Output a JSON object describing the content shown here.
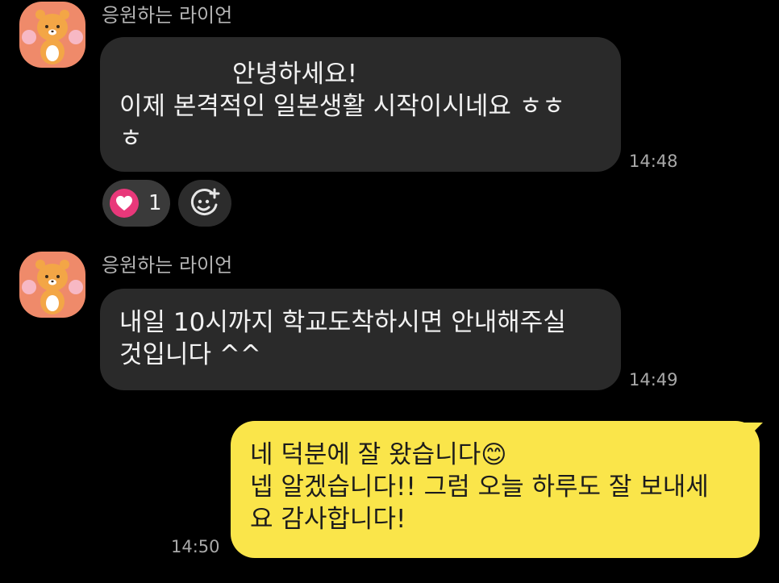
{
  "colors": {
    "background": "#000000",
    "incoming_bubble": "#2a2a2a",
    "outgoing_bubble": "#fae54a",
    "heart_reaction": "#e8387a",
    "avatar_bg": "#ef8a6a"
  },
  "messages": [
    {
      "sender": "응원하는 라이언",
      "lines": [
        "안녕하세요!",
        "이제 본격적인 일본생활 시작이시네요 ㅎㅎ",
        "ㅎ"
      ],
      "time": "14:48",
      "reaction": {
        "icon": "heart-icon",
        "count": "1"
      },
      "add_reaction_icon": "add-emoji-icon"
    },
    {
      "sender": "응원하는 라이언",
      "lines": [
        "내일 10시까지 학교도착하시면 안내해주실",
        "것입니다 ^^"
      ],
      "time": "14:49"
    },
    {
      "lines": [
        "네 덕분에 잘 왔습니다😊",
        "넵 알겠습니다!! 그럼 오늘 하루도 잘 보내세",
        "요 감사합니다!"
      ],
      "time": "14:50"
    }
  ]
}
